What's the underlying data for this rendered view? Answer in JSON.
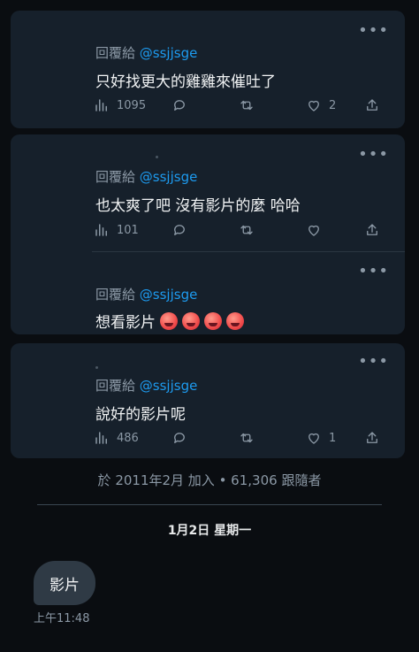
{
  "tweets": [
    {
      "reply_prefix": "回覆給",
      "handle": "@ssjjsge",
      "text": "只好找更大的雞雞來催吐了",
      "views": "1095",
      "retweets": "",
      "likes": "2"
    },
    {
      "reply_prefix": "回覆給",
      "handle": "@ssjjsge",
      "text": "也太爽了吧 沒有影片的麼 哈哈",
      "views": "101",
      "retweets": "",
      "likes": ""
    },
    {
      "reply_prefix": "回覆給",
      "handle": "@ssjjsge",
      "text": "想看影片",
      "emoji_count": 4,
      "emoji_name": "hot-face-emoji"
    },
    {
      "reply_prefix": "回覆給",
      "handle": "@ssjjsge",
      "text": "說好的影片呢",
      "views": "486",
      "retweets": "",
      "likes": "1"
    }
  ],
  "profile": {
    "joined_text": "於 2011年2月 加入 • 61,306 跟隨者"
  },
  "chat": {
    "date_label": "1月2日 星期一",
    "messages": [
      {
        "text": "影片",
        "time": "上午11:48"
      }
    ]
  },
  "icons": {
    "more": "more-icon",
    "views": "views-icon",
    "reply": "reply-icon",
    "retweet": "retweet-icon",
    "like": "like-icon",
    "share": "share-icon"
  },
  "colors": {
    "background": "#0a0d11",
    "card": "#16202b",
    "handle": "#1d9bf0",
    "muted": "#8b98a5",
    "bubble": "#2f3a45"
  }
}
